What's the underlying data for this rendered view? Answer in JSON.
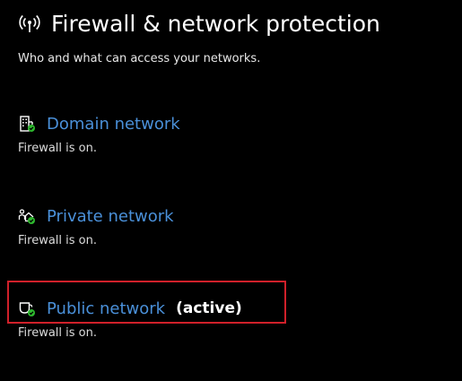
{
  "header": {
    "title": "Firewall & network protection",
    "icon": "wireless-signal-icon",
    "subtitle": "Who and what can access your networks."
  },
  "networks": [
    {
      "name": "Domain network",
      "icon": "domain-building-icon",
      "status": "Firewall is on.",
      "active_label": ""
    },
    {
      "name": "Private network",
      "icon": "private-home-icon",
      "status": "Firewall is on.",
      "active_label": ""
    },
    {
      "name": "Public network",
      "icon": "public-cafe-icon",
      "status": "Firewall is on.",
      "active_label": "(active)"
    }
  ],
  "colors": {
    "background": "#000000",
    "link": "#4a90d9",
    "status_ok": "#2eb82e",
    "highlight": "#d0202a"
  }
}
